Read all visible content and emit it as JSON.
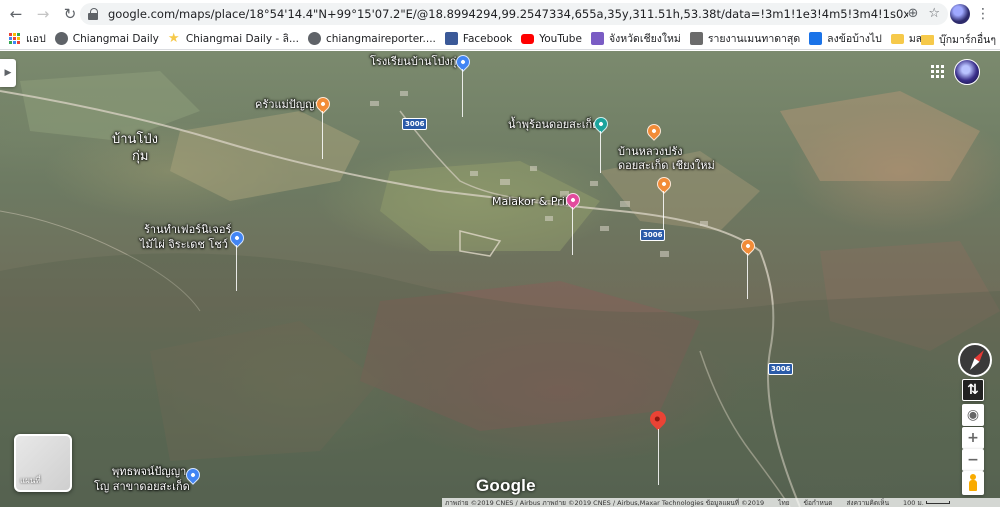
{
  "browser": {
    "url": "google.com/maps/place/18°54'14.4\"N+99°15'07.2\"E/@18.8994294,99.2547334,655a,35y,311.51h,53.38t/data=!3m1!1e3!4m5!3m4!1s0x0:0x0!8m2!3d18.904!4d99.252",
    "bookmarks": [
      {
        "label": "แอป",
        "icon": "apps-grid-icon"
      },
      {
        "label": "Chiangmai Daily",
        "icon": "globe-icon"
      },
      {
        "label": "Chiangmai Daily - ลิ...",
        "icon": "star-icon"
      },
      {
        "label": "chiangmaireporter....",
        "icon": "globe-icon"
      },
      {
        "label": "Facebook",
        "icon": "facebook-icon"
      },
      {
        "label": "YouTube",
        "icon": "youtube-icon"
      },
      {
        "label": "จังหวัดเชียงใหม่",
        "icon": "province-seal-icon"
      },
      {
        "label": "รายงานเมนทาดาสุด",
        "icon": "document-icon"
      },
      {
        "label": "ลงข้อบ้างไป",
        "icon": "blue-square-icon"
      },
      {
        "label": "มสธ",
        "icon": "folder-icon"
      }
    ],
    "bookmarks_more": "»",
    "other_bookmarks": "บุ๊กมาร์กอื่นๆ"
  },
  "map": {
    "labels": [
      {
        "text": "โรงเรียนบ้านโป่งกุ่ม",
        "name": "school-label"
      },
      {
        "text": "ครัวแม่ปัญญา",
        "name": "restaurant-label"
      },
      {
        "text": "บ้านโป่ง",
        "name": "village-label-1"
      },
      {
        "text": "กุ่ม",
        "name": "village-label-2"
      },
      {
        "text": "น้ำพุร้อนดอยสะเก็ด",
        "name": "hot-spring-label"
      },
      {
        "text": "บ้านหลวงปรัง",
        "name": "shop-label-1"
      },
      {
        "text": "ดอยสะเก็ด เชียงใหม่",
        "name": "shop-label-2"
      },
      {
        "text": "Malakor & Prik",
        "name": "hotel-label"
      },
      {
        "text": "ร้านทำเฟอร์นิเจอร์",
        "name": "furniture-label-1"
      },
      {
        "text": "ไม้ไผ่ จิระเดช โชว์",
        "name": "furniture-label-2"
      },
      {
        "text": "พุทธพจน์ปัญญา",
        "name": "temple-label-1"
      },
      {
        "text": "โญ สาขาดอยสะเก็ด",
        "name": "temple-label-2"
      }
    ],
    "road_shields": [
      "3006",
      "3006",
      "3006"
    ],
    "layer_label": "แผนที่",
    "logo": "Google",
    "attribution": "ภาพถ่าย ©2019 CNES / Airbus ภาพถ่าย ©2019 CNES / Airbus,Maxar Technologies ข้อมูลแผนที่ ©2019",
    "attribution_links": [
      "ไทย",
      "ข้อกำหนด",
      "ส่งความคิดเห็น"
    ],
    "scale": "100 ม.",
    "controls": {
      "zoom_in": "+",
      "zoom_out": "−"
    },
    "colors": {
      "pin_orange": "#f28c38",
      "pin_teal": "#1ba39c",
      "pin_pink": "#e24a9d",
      "pin_blue": "#4285f4",
      "pin_red": "#ea4335",
      "shield_blue": "#2a5aa8"
    }
  }
}
